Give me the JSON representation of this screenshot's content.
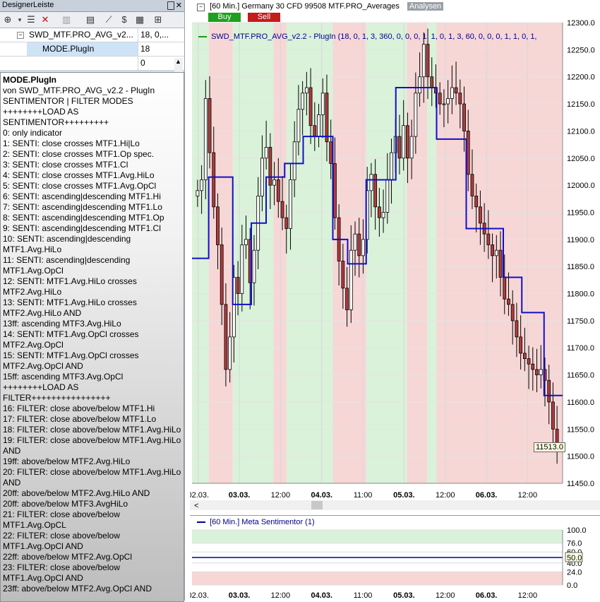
{
  "panel": {
    "title": "DesignerLeiste",
    "close_glyph": "✕",
    "toolbar_icons": [
      "add-icon",
      "dropdown-icon",
      "list-icon",
      "delete-icon",
      "save-icon",
      "print-icon",
      "line-icon",
      "dollar-icon",
      "grid-icon",
      "pin-icon"
    ],
    "rows": [
      {
        "name": "SWD_MTF.PRO_AVG_v2...",
        "value": "18, 0,...",
        "expander": "⊟"
      },
      {
        "name": "MODE.PlugIn",
        "value": "18"
      },
      {
        "name": "",
        "value": "0"
      }
    ],
    "description_title": "MODE.PlugIn",
    "description_lines": [
      "von SWD_MTF.PRO_AVG_v2.2 - PlugIn",
      "SENTIMENTOR | FILTER MODES",
      "++++++++LOAD AS",
      "SENTIMENTOR+++++++++",
      "0: only indicator",
      "1: SENTI: close crosses MTF1.Hi|Lo",
      "2: SENTI: close crosses MTF1.Op spec.",
      "3: SENTI: close crosses MTF1.Cl",
      "4: SENTI: close crosses MTF1.Avg.HiLo",
      "5: SENTI: close crosses MTF1.Avg.OpCl",
      "6: SENTI: ascending|descending MTF1.Hi",
      "7: SENTI: ascending|descending MTF1.Lo",
      "8: SENTI: ascending|descending MTF1.Op",
      "9: SENTI: ascending|descending MTF1.Cl",
      "10: SENTI: ascending|descending",
      "MTF1.Avg.HiLo",
      "11: SENTI: ascending|descending",
      "MTF1.Avg.OpCl",
      "12: SENTI: MTF1.Avg.HiLo crosses",
      "MTF2.Avg.HiLo",
      "13: SENTI: MTF1.Avg.HiLo crosses",
      "MTF2.Avg.HiLo AND",
      "13ff: ascending MTF3.Avg.HiLo",
      "14: SENTI: MTF1.Avg.OpCl crosses",
      "MTF2.Avg.OpCl",
      "15: SENTI: MTF1.Avg.OpCl crosses",
      "MTF2.Avg.OpCl AND",
      "15ff: ascending MTF3.Avg.OpCl",
      "++++++++LOAD AS",
      "FILTER++++++++++++++++",
      "16: FILTER: close above/below MTF1.Hi",
      "17: FILTER: close above/below MTF1.Lo",
      "18: FILTER: close above/below MTF1.Avg.HiLo",
      "19: FILTER: close above/below MTF1.Avg.HiLo",
      "AND",
      "19ff: above/below MTF2.Avg.HiLo",
      "20: FILTER: close above/below MTF1.Avg.HiLo",
      "AND",
      "20ff: above/below MTF2.Avg.HiLo AND",
      "20ff: above/below MTF3.AvgHiLo",
      "21: FILTER: close above/below",
      "MTF1.Avg.OpCL",
      "22: FILTER: close above/below",
      "MTF1.Avg.OpCl AND",
      "22ff: above/below MTF2.Avg.OpCl",
      "23: FILTER: close above/below",
      "MTF1.Avg.OpCl AND",
      "23ff: above/below MTF2.Avg.OpCl AND"
    ]
  },
  "chart": {
    "header_text": "[60 Min.] Germany 30 CFD   99508 MTF.PRO_Averages",
    "analysen_label": "Analysen",
    "buy_label": "Buy",
    "sell_label": "Sell",
    "indicator_text": "SWD_MTF.PRO_AVG_v2.2 - PlugIn  (18, 0, 1, 3, 360, 0, 0, 0, 1, 1, 0, 1, 3, 60, 0, 0, 0, 1, 1, 0, 1,",
    "last_price": "11513.0",
    "colors": {
      "up": "#ffffff",
      "down": "#b23b3b",
      "avg_line": "#1010c8",
      "green_bg": "#d9f2d9",
      "red_bg": "#f7d6d6"
    },
    "x_tick_labels": [
      "02.03.",
      "03.03.",
      "12:00",
      "04.03.",
      "11:00",
      "05.03.",
      "12:00",
      "06.03.",
      "12:00"
    ],
    "bold_x_ticks": [
      false,
      true,
      false,
      true,
      false,
      true,
      false,
      true,
      false
    ],
    "y_tick_labels": [
      "12300.0",
      "12250.0",
      "12200.0",
      "12150.0",
      "12100.0",
      "12050.0",
      "12000.0",
      "11950.0",
      "11900.0",
      "11850.0",
      "11800.0",
      "11750.0",
      "11700.0",
      "11650.0",
      "11600.0",
      "11550.0",
      "11500.0",
      "11450.0"
    ]
  },
  "chart_data": {
    "type": "candlestick",
    "x_tick_labels": [
      "02.03.",
      "03.03.",
      "12:00",
      "04.03.",
      "11:00",
      "05.03.",
      "12:00",
      "06.03.",
      "12:00"
    ],
    "y_range": [
      11450,
      12300
    ],
    "last_price": 11513.0,
    "background_zones": [
      {
        "sentiment": "green",
        "from": 0.0,
        "to": 0.045
      },
      {
        "sentiment": "red",
        "from": 0.045,
        "to": 0.11
      },
      {
        "sentiment": "green",
        "from": 0.11,
        "to": 0.22
      },
      {
        "sentiment": "red",
        "from": 0.22,
        "to": 0.255
      },
      {
        "sentiment": "green",
        "from": 0.255,
        "to": 0.38
      },
      {
        "sentiment": "red",
        "from": 0.38,
        "to": 0.47
      },
      {
        "sentiment": "green",
        "from": 0.47,
        "to": 0.58
      },
      {
        "sentiment": "red",
        "from": 0.58,
        "to": 0.635
      },
      {
        "sentiment": "green",
        "from": 0.635,
        "to": 0.66
      },
      {
        "sentiment": "red",
        "from": 0.66,
        "to": 1.0
      }
    ],
    "close_series": [
      11990,
      12010,
      12160,
      12060,
      11960,
      11890,
      11780,
      11660,
      11720,
      11830,
      11800,
      11890,
      11900,
      11820,
      11880,
      11980,
      12050,
      12070,
      12000,
      12010,
      11970,
      11940,
      11920,
      12010,
      12080,
      12140,
      12170,
      12180,
      12110,
      12090,
      12130,
      12170,
      12080,
      12040,
      11940,
      11860,
      11810,
      11770,
      11880,
      11910,
      11870,
      11900,
      11990,
      12020,
      11960,
      11940,
      11950,
      12010,
      12060,
      12090,
      12050,
      12110,
      12050,
      12090,
      12170,
      12200,
      12260,
      12200,
      12180,
      12170,
      12150,
      12150,
      12160,
      12180,
      12170,
      12150,
      12100,
      12020,
      11980,
      11960,
      11930,
      11910,
      11890,
      11870,
      11880,
      11830,
      11790,
      11780,
      11750,
      11720,
      11690,
      11680,
      11670,
      11660,
      11650,
      11660,
      11640,
      11600,
      11550,
      11513
    ],
    "avg_step_series": [
      {
        "value": 11865,
        "from": 0.0,
        "to": 0.045
      },
      {
        "value": 12015,
        "from": 0.045,
        "to": 0.11
      },
      {
        "value": 11780,
        "from": 0.11,
        "to": 0.16
      },
      {
        "value": 11930,
        "from": 0.16,
        "to": 0.2
      },
      {
        "value": 12015,
        "from": 0.2,
        "to": 0.25
      },
      {
        "value": 12040,
        "from": 0.25,
        "to": 0.3
      },
      {
        "value": 12090,
        "from": 0.3,
        "to": 0.38
      },
      {
        "value": 11900,
        "from": 0.38,
        "to": 0.42
      },
      {
        "value": 11855,
        "from": 0.42,
        "to": 0.47
      },
      {
        "value": 12010,
        "from": 0.47,
        "to": 0.55
      },
      {
        "value": 12180,
        "from": 0.55,
        "to": 0.66
      },
      {
        "value": 12085,
        "from": 0.66,
        "to": 0.74
      },
      {
        "value": 11920,
        "from": 0.74,
        "to": 0.84
      },
      {
        "value": 11830,
        "from": 0.84,
        "to": 0.89
      },
      {
        "value": 11765,
        "from": 0.89,
        "to": 0.95
      },
      {
        "value": 11612,
        "from": 0.95,
        "to": 1.0
      }
    ],
    "sub_indicator": {
      "title": "[60 Min.] Meta Sentimentor  (1)",
      "value": 50.0,
      "value_label": "50.0",
      "y_range": [
        0,
        100
      ],
      "y_tick_labels": [
        "100.0",
        "76.0",
        "60.0",
        "50.0",
        "40.0",
        "24.0",
        "0.0"
      ],
      "x_tick_labels": [
        "02.03.",
        "03.03.",
        "12:00",
        "04.03.",
        "11:00",
        "05.03.",
        "12:00",
        "06.03.",
        "12:00"
      ]
    }
  }
}
